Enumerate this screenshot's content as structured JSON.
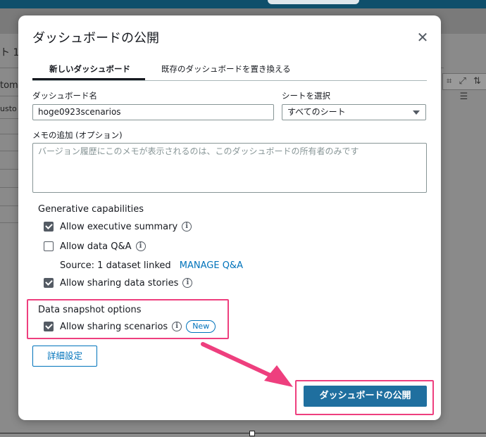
{
  "background": {
    "tab_partial": "ト 1",
    "col_partial": "tome",
    "cell_partial": "usto",
    "toolbar_icons": "⌗ ⤢ ⇅ ☰"
  },
  "dialog": {
    "title": "ダッシュボードの公開",
    "close_icon": "close-icon",
    "tabs": [
      {
        "label": "新しいダッシュボード",
        "active": true
      },
      {
        "label": "既存のダッシュボードを置き換える",
        "active": false
      }
    ],
    "dashboard_name_label": "ダッシュボード名",
    "dashboard_name_value": "hoge0923scenarios",
    "sheet_select_label": "シートを選択",
    "sheet_select_value": "すべてのシート",
    "memo_label": "メモの追加 (オプション)",
    "memo_placeholder": "バージョン履歴にこのメモが表示されるのは、このダッシュボードの所有者のみです",
    "generative": {
      "heading": "Generative capabilities",
      "exec_summary": {
        "label": "Allow executive summary",
        "checked": true
      },
      "data_qa": {
        "label": "Allow data Q&A",
        "checked": false
      },
      "source_prefix": "Source:",
      "source_value": "1 dataset linked",
      "manage_link": "MANAGE Q&A",
      "data_stories": {
        "label": "Allow sharing data stories",
        "checked": true
      }
    },
    "snapshot": {
      "heading": "Data snapshot options",
      "scenarios": {
        "label": "Allow sharing scenarios",
        "checked": true
      },
      "badge": "New"
    },
    "advanced_button": "詳細設定",
    "publish_button": "ダッシュボードの公開",
    "info_glyph": "i"
  },
  "colors": {
    "highlight": "#ee3f7e",
    "primary": "#1f6f9f",
    "link": "#0073bb"
  }
}
